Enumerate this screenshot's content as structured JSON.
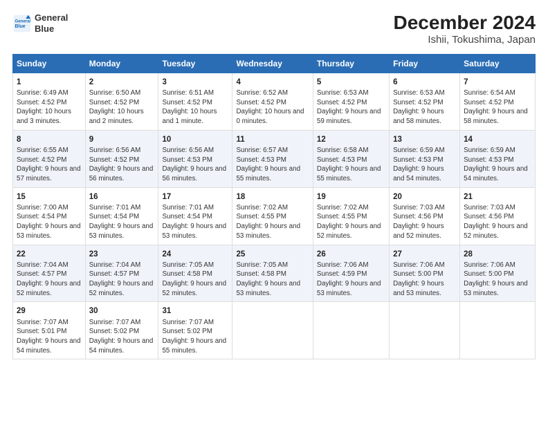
{
  "header": {
    "logo_line1": "General",
    "logo_line2": "Blue",
    "title": "December 2024",
    "subtitle": "Ishii, Tokushima, Japan"
  },
  "days_of_week": [
    "Sunday",
    "Monday",
    "Tuesday",
    "Wednesday",
    "Thursday",
    "Friday",
    "Saturday"
  ],
  "weeks": [
    [
      {
        "day": "1",
        "rise": "Sunrise: 6:49 AM",
        "set": "Sunset: 4:52 PM",
        "daylight": "Daylight: 10 hours and 3 minutes."
      },
      {
        "day": "2",
        "rise": "Sunrise: 6:50 AM",
        "set": "Sunset: 4:52 PM",
        "daylight": "Daylight: 10 hours and 2 minutes."
      },
      {
        "day": "3",
        "rise": "Sunrise: 6:51 AM",
        "set": "Sunset: 4:52 PM",
        "daylight": "Daylight: 10 hours and 1 minute."
      },
      {
        "day": "4",
        "rise": "Sunrise: 6:52 AM",
        "set": "Sunset: 4:52 PM",
        "daylight": "Daylight: 10 hours and 0 minutes."
      },
      {
        "day": "5",
        "rise": "Sunrise: 6:53 AM",
        "set": "Sunset: 4:52 PM",
        "daylight": "Daylight: 9 hours and 59 minutes."
      },
      {
        "day": "6",
        "rise": "Sunrise: 6:53 AM",
        "set": "Sunset: 4:52 PM",
        "daylight": "Daylight: 9 hours and 58 minutes."
      },
      {
        "day": "7",
        "rise": "Sunrise: 6:54 AM",
        "set": "Sunset: 4:52 PM",
        "daylight": "Daylight: 9 hours and 58 minutes."
      }
    ],
    [
      {
        "day": "8",
        "rise": "Sunrise: 6:55 AM",
        "set": "Sunset: 4:52 PM",
        "daylight": "Daylight: 9 hours and 57 minutes."
      },
      {
        "day": "9",
        "rise": "Sunrise: 6:56 AM",
        "set": "Sunset: 4:52 PM",
        "daylight": "Daylight: 9 hours and 56 minutes."
      },
      {
        "day": "10",
        "rise": "Sunrise: 6:56 AM",
        "set": "Sunset: 4:53 PM",
        "daylight": "Daylight: 9 hours and 56 minutes."
      },
      {
        "day": "11",
        "rise": "Sunrise: 6:57 AM",
        "set": "Sunset: 4:53 PM",
        "daylight": "Daylight: 9 hours and 55 minutes."
      },
      {
        "day": "12",
        "rise": "Sunrise: 6:58 AM",
        "set": "Sunset: 4:53 PM",
        "daylight": "Daylight: 9 hours and 55 minutes."
      },
      {
        "day": "13",
        "rise": "Sunrise: 6:59 AM",
        "set": "Sunset: 4:53 PM",
        "daylight": "Daylight: 9 hours and 54 minutes."
      },
      {
        "day": "14",
        "rise": "Sunrise: 6:59 AM",
        "set": "Sunset: 4:53 PM",
        "daylight": "Daylight: 9 hours and 54 minutes."
      }
    ],
    [
      {
        "day": "15",
        "rise": "Sunrise: 7:00 AM",
        "set": "Sunset: 4:54 PM",
        "daylight": "Daylight: 9 hours and 53 minutes."
      },
      {
        "day": "16",
        "rise": "Sunrise: 7:01 AM",
        "set": "Sunset: 4:54 PM",
        "daylight": "Daylight: 9 hours and 53 minutes."
      },
      {
        "day": "17",
        "rise": "Sunrise: 7:01 AM",
        "set": "Sunset: 4:54 PM",
        "daylight": "Daylight: 9 hours and 53 minutes."
      },
      {
        "day": "18",
        "rise": "Sunrise: 7:02 AM",
        "set": "Sunset: 4:55 PM",
        "daylight": "Daylight: 9 hours and 53 minutes."
      },
      {
        "day": "19",
        "rise": "Sunrise: 7:02 AM",
        "set": "Sunset: 4:55 PM",
        "daylight": "Daylight: 9 hours and 52 minutes."
      },
      {
        "day": "20",
        "rise": "Sunrise: 7:03 AM",
        "set": "Sunset: 4:56 PM",
        "daylight": "Daylight: 9 hours and 52 minutes."
      },
      {
        "day": "21",
        "rise": "Sunrise: 7:03 AM",
        "set": "Sunset: 4:56 PM",
        "daylight": "Daylight: 9 hours and 52 minutes."
      }
    ],
    [
      {
        "day": "22",
        "rise": "Sunrise: 7:04 AM",
        "set": "Sunset: 4:57 PM",
        "daylight": "Daylight: 9 hours and 52 minutes."
      },
      {
        "day": "23",
        "rise": "Sunrise: 7:04 AM",
        "set": "Sunset: 4:57 PM",
        "daylight": "Daylight: 9 hours and 52 minutes."
      },
      {
        "day": "24",
        "rise": "Sunrise: 7:05 AM",
        "set": "Sunset: 4:58 PM",
        "daylight": "Daylight: 9 hours and 52 minutes."
      },
      {
        "day": "25",
        "rise": "Sunrise: 7:05 AM",
        "set": "Sunset: 4:58 PM",
        "daylight": "Daylight: 9 hours and 53 minutes."
      },
      {
        "day": "26",
        "rise": "Sunrise: 7:06 AM",
        "set": "Sunset: 4:59 PM",
        "daylight": "Daylight: 9 hours and 53 minutes."
      },
      {
        "day": "27",
        "rise": "Sunrise: 7:06 AM",
        "set": "Sunset: 5:00 PM",
        "daylight": "Daylight: 9 hours and 53 minutes."
      },
      {
        "day": "28",
        "rise": "Sunrise: 7:06 AM",
        "set": "Sunset: 5:00 PM",
        "daylight": "Daylight: 9 hours and 53 minutes."
      }
    ],
    [
      {
        "day": "29",
        "rise": "Sunrise: 7:07 AM",
        "set": "Sunset: 5:01 PM",
        "daylight": "Daylight: 9 hours and 54 minutes."
      },
      {
        "day": "30",
        "rise": "Sunrise: 7:07 AM",
        "set": "Sunset: 5:02 PM",
        "daylight": "Daylight: 9 hours and 54 minutes."
      },
      {
        "day": "31",
        "rise": "Sunrise: 7:07 AM",
        "set": "Sunset: 5:02 PM",
        "daylight": "Daylight: 9 hours and 55 minutes."
      },
      null,
      null,
      null,
      null
    ]
  ]
}
